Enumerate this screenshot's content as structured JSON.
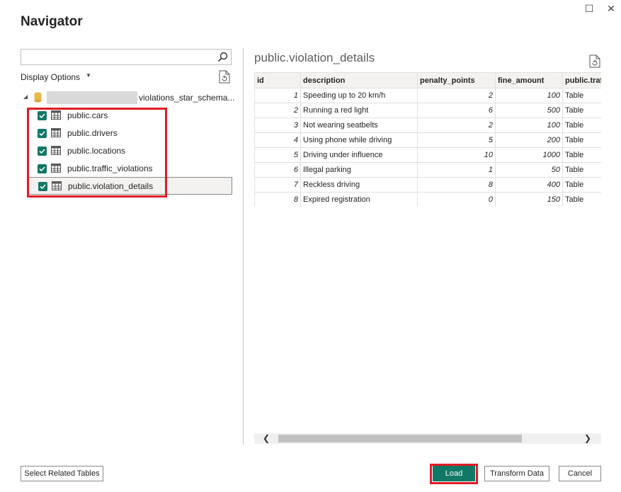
{
  "window": {
    "title": "Navigator",
    "maximize_icon": "☐",
    "close_icon": "✕"
  },
  "left_pane": {
    "search": {
      "value": "",
      "placeholder": ""
    },
    "display_options_label": "Display Options",
    "tree": {
      "root_label": "violations_star_schema...",
      "items": [
        {
          "label": "public.cars",
          "checked": true
        },
        {
          "label": "public.drivers",
          "checked": true
        },
        {
          "label": "public.locations",
          "checked": true
        },
        {
          "label": "public.traffic_violations",
          "checked": true
        },
        {
          "label": "public.violation_details",
          "checked": true,
          "selected": true
        }
      ]
    }
  },
  "preview": {
    "title": "public.violation_details",
    "columns": [
      "id",
      "description",
      "penalty_points",
      "fine_amount",
      "public.traffic_violations"
    ],
    "rows": [
      [
        "1",
        "Speeding up to 20 km/h",
        "2",
        "100",
        "Table"
      ],
      [
        "2",
        "Running a red light",
        "6",
        "500",
        "Table"
      ],
      [
        "3",
        "Not wearing seatbelts",
        "2",
        "100",
        "Table"
      ],
      [
        "4",
        "Using phone while driving",
        "5",
        "200",
        "Table"
      ],
      [
        "5",
        "Driving under influence",
        "10",
        "1000",
        "Table"
      ],
      [
        "6",
        "Illegal parking",
        "1",
        "50",
        "Table"
      ],
      [
        "7",
        "Reckless driving",
        "8",
        "400",
        "Table"
      ],
      [
        "8",
        "Expired registration",
        "0",
        "150",
        "Table"
      ]
    ]
  },
  "footer": {
    "select_related_label": "Select Related Tables",
    "load_label": "Load",
    "transform_label": "Transform Data",
    "cancel_label": "Cancel"
  },
  "colors": {
    "accent": "#117865",
    "highlight_border": "#e01b24"
  }
}
